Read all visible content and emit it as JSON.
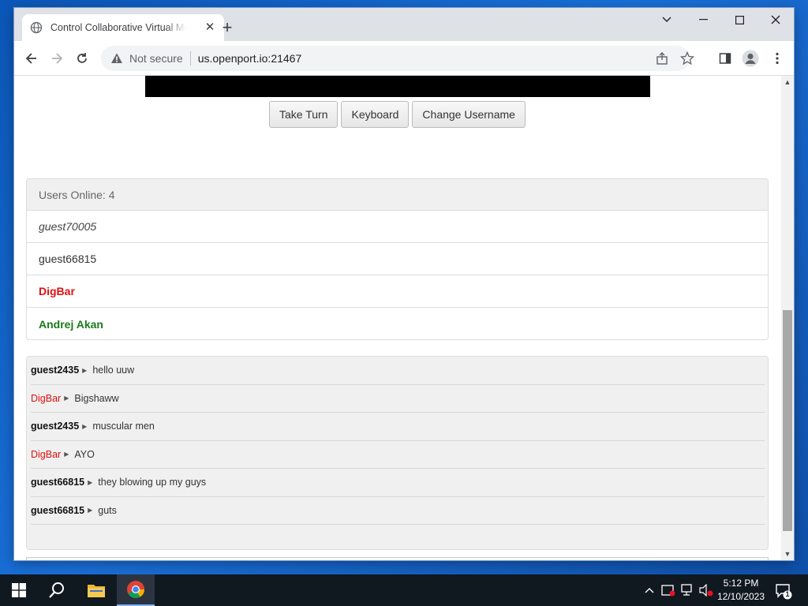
{
  "browser": {
    "tab_title": "Control Collaborative Virtual Machine",
    "not_secure_label": "Not secure",
    "url": "us.openport.io:21467"
  },
  "page": {
    "buttons": {
      "take_turn": "Take Turn",
      "keyboard": "Keyboard",
      "change_username": "Change Username"
    },
    "users_panel": {
      "header": "Users Online: 4",
      "users": [
        {
          "name": "guest70005",
          "style": "italic"
        },
        {
          "name": "guest66815",
          "style": "normal"
        },
        {
          "name": "DigBar",
          "style": "red"
        },
        {
          "name": "Andrej Akan",
          "style": "green"
        }
      ]
    },
    "chat": {
      "messages": [
        {
          "user": "guest2435",
          "text": "hello uuw",
          "user_color": "default"
        },
        {
          "user": "DigBar",
          "text": "Bigshaww",
          "user_color": "red"
        },
        {
          "user": "guest2435",
          "text": "muscular men",
          "user_color": "default"
        },
        {
          "user": "DigBar",
          "text": "AYO",
          "user_color": "red"
        },
        {
          "user": "guest66815",
          "text": "they blowing up my guys",
          "user_color": "default"
        },
        {
          "user": "guest66815",
          "text": "guts",
          "user_color": "default"
        }
      ]
    }
  },
  "taskbar": {
    "time": "5:12 PM",
    "date": "12/10/2023",
    "notification_count": "1"
  },
  "colors": {
    "accent_red": "#dd1111",
    "accent_green": "#1a7a1a",
    "taskbar_bg": "#101820"
  }
}
